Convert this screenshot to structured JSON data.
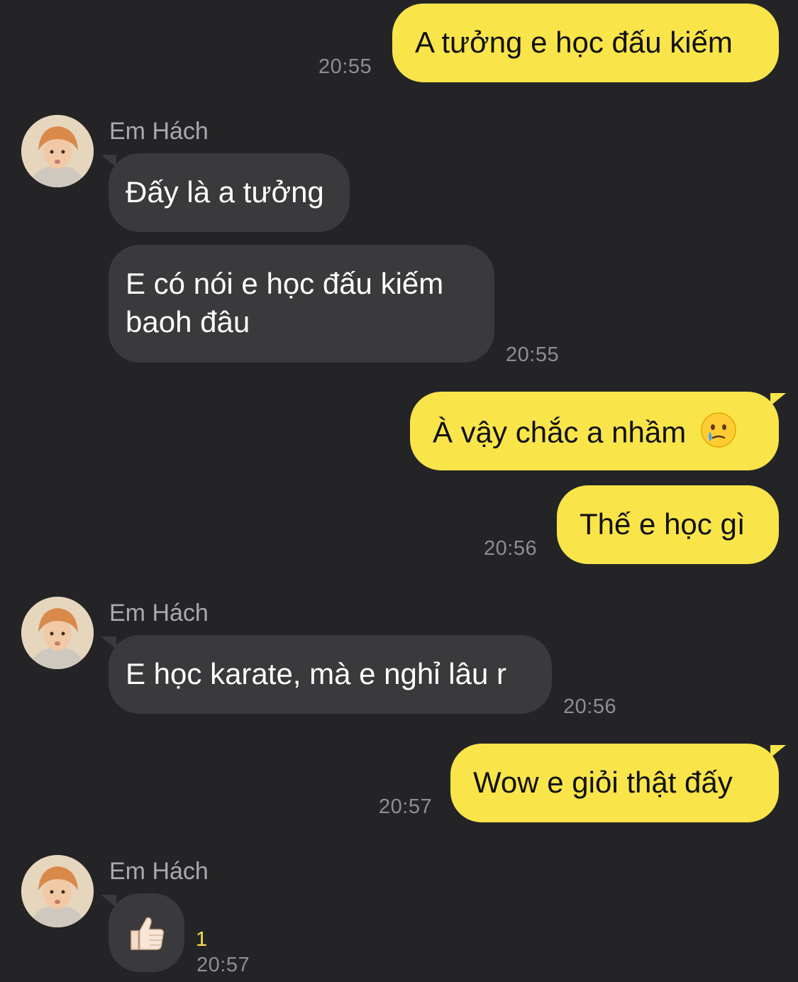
{
  "contact": {
    "name": "Em Hách"
  },
  "messages": [
    {
      "from": "me",
      "text": "A tưởng e học đấu kiếm",
      "time": "20:55"
    },
    {
      "from": "them",
      "text": "Đấy là a tưởng"
    },
    {
      "from": "them",
      "lines": [
        "E có nói e học đấu kiếm",
        "baoh đâu"
      ],
      "time": "20:55"
    },
    {
      "from": "me",
      "text": "À vậy chắc a nhầm",
      "emoji": "crying-face-emoji"
    },
    {
      "from": "me",
      "text": "Thế e học gì",
      "time": "20:56"
    },
    {
      "from": "them",
      "text": "E học karate, mà e nghỉ lâu r",
      "time": "20:56"
    },
    {
      "from": "me",
      "text": "Wow e giỏi thật đấy",
      "time": "20:57"
    },
    {
      "from": "them",
      "emoji": "thumbs-up-emoji",
      "unread": "1",
      "time": "20:57"
    }
  ],
  "colors": {
    "background": "#242426",
    "my_bubble": "#f9e54a",
    "their_bubble": "#3a3a3c",
    "timestamp": "#8e8e93",
    "unread_count": "#f9e54a"
  }
}
